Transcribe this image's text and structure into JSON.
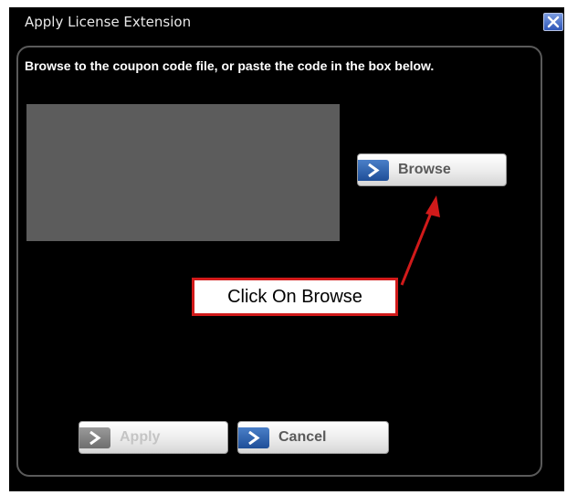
{
  "window": {
    "title": "Apply License Extension",
    "close_icon": "close-icon"
  },
  "main": {
    "instruction": "Browse to the coupon code file, or paste the code in the box below.",
    "code_box_value": ""
  },
  "buttons": {
    "browse_label": "Browse",
    "apply_label": "Apply",
    "cancel_label": "Cancel",
    "chevron_icon": "chevron-right-icon"
  },
  "annotation": {
    "callout_text": "Click On Browse",
    "color": "#d11a1a"
  },
  "colors": {
    "window_bg": "#000000",
    "button_accent": "#2f63b0",
    "text_box_bg": "#5c5c5c"
  }
}
